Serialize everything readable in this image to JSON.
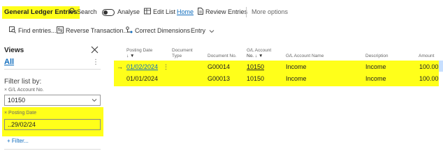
{
  "toolbar": {
    "title": "General Ledger Entries",
    "search": "Search",
    "analyse": "Analyse",
    "edit_list": "Edit List",
    "home": "Home",
    "review": "Review Entries",
    "more": "More options"
  },
  "actions": {
    "find": "Find entries...",
    "reverse": "Reverse Transaction...",
    "correct": "Correct Dimensions",
    "entry": "Entry"
  },
  "pane": {
    "views_title": "Views",
    "all": "All",
    "filter_by": "Filter list by:",
    "filter1_label": "× G/L Account No.",
    "filter1_value": "10150",
    "filter2_label": "× Posting Date",
    "filter2_value": "..29/02/24",
    "add_filter": "+ Filter..."
  },
  "grid": {
    "headers": {
      "posting_date_1": "Posting Date",
      "posting_date_2": "↓ ▼",
      "doc_type_1": "Document",
      "doc_type_2": "Type",
      "doc_no": "Document No.",
      "gl_acc_1": "G/L Account",
      "gl_acc_2": "No. ↓ ▼",
      "gl_name": "G/L Account Name",
      "description": "Description",
      "amount": "Amount"
    },
    "rows": [
      {
        "arrow": "→",
        "posting_date": "01/02/2024",
        "menu": "⋮",
        "doc_type": "",
        "doc_no": "G00014",
        "gl_no": "10150",
        "gl_name": "Income",
        "description": "Income",
        "amount": "100.00"
      },
      {
        "arrow": "",
        "posting_date": "01/01/2024",
        "menu": "",
        "doc_type": "",
        "doc_no": "G00013",
        "gl_no": "10150",
        "gl_name": "Income",
        "description": "Income",
        "amount": "100.00"
      }
    ]
  },
  "colors": {
    "highlight": "#ffff1a",
    "link": "#0f6cbd"
  }
}
